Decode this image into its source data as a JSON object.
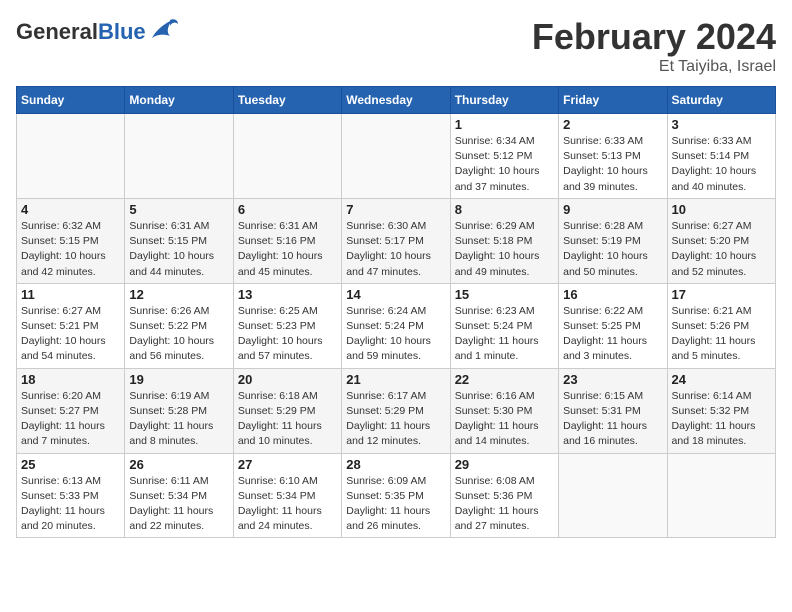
{
  "header": {
    "logo_general": "General",
    "logo_blue": "Blue",
    "month_title": "February 2024",
    "location": "Et Taiyiba, Israel"
  },
  "weekdays": [
    "Sunday",
    "Monday",
    "Tuesday",
    "Wednesday",
    "Thursday",
    "Friday",
    "Saturday"
  ],
  "weeks": [
    [
      {
        "day": "",
        "info": ""
      },
      {
        "day": "",
        "info": ""
      },
      {
        "day": "",
        "info": ""
      },
      {
        "day": "",
        "info": ""
      },
      {
        "day": "1",
        "info": "Sunrise: 6:34 AM\nSunset: 5:12 PM\nDaylight: 10 hours\nand 37 minutes."
      },
      {
        "day": "2",
        "info": "Sunrise: 6:33 AM\nSunset: 5:13 PM\nDaylight: 10 hours\nand 39 minutes."
      },
      {
        "day": "3",
        "info": "Sunrise: 6:33 AM\nSunset: 5:14 PM\nDaylight: 10 hours\nand 40 minutes."
      }
    ],
    [
      {
        "day": "4",
        "info": "Sunrise: 6:32 AM\nSunset: 5:15 PM\nDaylight: 10 hours\nand 42 minutes."
      },
      {
        "day": "5",
        "info": "Sunrise: 6:31 AM\nSunset: 5:15 PM\nDaylight: 10 hours\nand 44 minutes."
      },
      {
        "day": "6",
        "info": "Sunrise: 6:31 AM\nSunset: 5:16 PM\nDaylight: 10 hours\nand 45 minutes."
      },
      {
        "day": "7",
        "info": "Sunrise: 6:30 AM\nSunset: 5:17 PM\nDaylight: 10 hours\nand 47 minutes."
      },
      {
        "day": "8",
        "info": "Sunrise: 6:29 AM\nSunset: 5:18 PM\nDaylight: 10 hours\nand 49 minutes."
      },
      {
        "day": "9",
        "info": "Sunrise: 6:28 AM\nSunset: 5:19 PM\nDaylight: 10 hours\nand 50 minutes."
      },
      {
        "day": "10",
        "info": "Sunrise: 6:27 AM\nSunset: 5:20 PM\nDaylight: 10 hours\nand 52 minutes."
      }
    ],
    [
      {
        "day": "11",
        "info": "Sunrise: 6:27 AM\nSunset: 5:21 PM\nDaylight: 10 hours\nand 54 minutes."
      },
      {
        "day": "12",
        "info": "Sunrise: 6:26 AM\nSunset: 5:22 PM\nDaylight: 10 hours\nand 56 minutes."
      },
      {
        "day": "13",
        "info": "Sunrise: 6:25 AM\nSunset: 5:23 PM\nDaylight: 10 hours\nand 57 minutes."
      },
      {
        "day": "14",
        "info": "Sunrise: 6:24 AM\nSunset: 5:24 PM\nDaylight: 10 hours\nand 59 minutes."
      },
      {
        "day": "15",
        "info": "Sunrise: 6:23 AM\nSunset: 5:24 PM\nDaylight: 11 hours\nand 1 minute."
      },
      {
        "day": "16",
        "info": "Sunrise: 6:22 AM\nSunset: 5:25 PM\nDaylight: 11 hours\nand 3 minutes."
      },
      {
        "day": "17",
        "info": "Sunrise: 6:21 AM\nSunset: 5:26 PM\nDaylight: 11 hours\nand 5 minutes."
      }
    ],
    [
      {
        "day": "18",
        "info": "Sunrise: 6:20 AM\nSunset: 5:27 PM\nDaylight: 11 hours\nand 7 minutes."
      },
      {
        "day": "19",
        "info": "Sunrise: 6:19 AM\nSunset: 5:28 PM\nDaylight: 11 hours\nand 8 minutes."
      },
      {
        "day": "20",
        "info": "Sunrise: 6:18 AM\nSunset: 5:29 PM\nDaylight: 11 hours\nand 10 minutes."
      },
      {
        "day": "21",
        "info": "Sunrise: 6:17 AM\nSunset: 5:29 PM\nDaylight: 11 hours\nand 12 minutes."
      },
      {
        "day": "22",
        "info": "Sunrise: 6:16 AM\nSunset: 5:30 PM\nDaylight: 11 hours\nand 14 minutes."
      },
      {
        "day": "23",
        "info": "Sunrise: 6:15 AM\nSunset: 5:31 PM\nDaylight: 11 hours\nand 16 minutes."
      },
      {
        "day": "24",
        "info": "Sunrise: 6:14 AM\nSunset: 5:32 PM\nDaylight: 11 hours\nand 18 minutes."
      }
    ],
    [
      {
        "day": "25",
        "info": "Sunrise: 6:13 AM\nSunset: 5:33 PM\nDaylight: 11 hours\nand 20 minutes."
      },
      {
        "day": "26",
        "info": "Sunrise: 6:11 AM\nSunset: 5:34 PM\nDaylight: 11 hours\nand 22 minutes."
      },
      {
        "day": "27",
        "info": "Sunrise: 6:10 AM\nSunset: 5:34 PM\nDaylight: 11 hours\nand 24 minutes."
      },
      {
        "day": "28",
        "info": "Sunrise: 6:09 AM\nSunset: 5:35 PM\nDaylight: 11 hours\nand 26 minutes."
      },
      {
        "day": "29",
        "info": "Sunrise: 6:08 AM\nSunset: 5:36 PM\nDaylight: 11 hours\nand 27 minutes."
      },
      {
        "day": "",
        "info": ""
      },
      {
        "day": "",
        "info": ""
      }
    ]
  ]
}
